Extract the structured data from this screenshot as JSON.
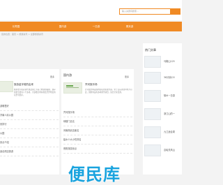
{
  "search": {
    "placeholder": "输入关键词搜索..."
  },
  "nav": {
    "items": [
      "长寿园",
      "国内游",
      "一日游",
      "周末游"
    ]
  },
  "breadcrumb": "您的位置：首页 > 旅游资讯 > 全部旅游资讯",
  "left_panel": {
    "title": "",
    "more": "更多",
    "featured": {
      "title": "旅游金字塔的由来",
      "desc": "旅游金字塔是古代埃及国王为自己修建的陵墓，现存的金字塔有八十多座，大多数分布在埃及开罗附近的尼罗河西岸。"
    },
    "items": [
      "",
      ""
    ]
  },
  "mid_panel": {
    "title": "国内游",
    "more": "更多",
    "featured": {
      "title": "齐河旅乐场",
      "desc": "齐河旅乐场是国内知名的主题乐园，位于山东省德州市齐河县，园区内设有多种游乐项目，适合全家出游。"
    },
    "items": [
      "齐河旅乐场",
      "琼楼门店名",
      "河南嵩武店面名",
      "建水十大小吃排名",
      "嵩阳旅游景点"
    ]
  },
  "left_list": [
    "游哪里好",
    "济南人民公园",
    "安排行",
    "公园",
    "景点介绍",
    "适合周边旅游"
  ],
  "right_panel": {
    "title": "热门文章",
    "items": [
      "马鞍山125",
      "36分钟小5",
      "徐州一日游",
      "浙江山的一",
      "九江适合周",
      "嘉峪关风山"
    ]
  },
  "watermark": "便民库"
}
